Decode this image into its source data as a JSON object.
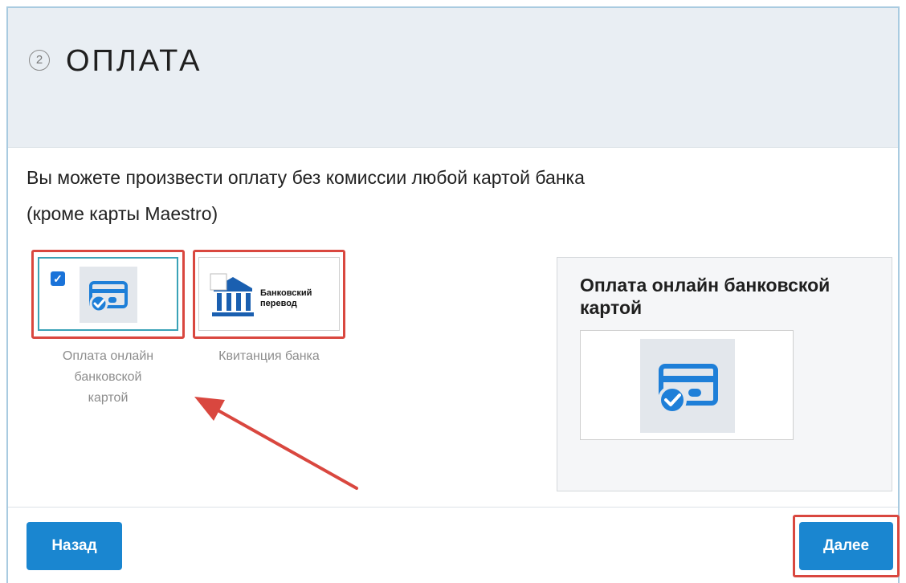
{
  "header": {
    "step_number": "2",
    "title": "ОПЛАТА"
  },
  "description": {
    "line1": "Вы можете произвести оплату без комиссии любой картой банка",
    "line2": "(кроме карты Maestro)"
  },
  "payment_options": [
    {
      "label_lines": [
        "Оплата онлайн",
        "банковской",
        "картой"
      ],
      "selected": true,
      "icon": "credit-card-icon"
    },
    {
      "label_lines": [
        "Квитанция банка"
      ],
      "selected": false,
      "icon": "bank-building-icon",
      "logo_text": [
        "Банковский",
        "перевод"
      ]
    }
  ],
  "summary": {
    "title": "Оплата онлайн банковской картой",
    "icon": "credit-card-icon"
  },
  "buttons": {
    "back": "Назад",
    "next": "Далее"
  },
  "colors": {
    "accent": "#1a86d0",
    "highlight": "#d9473f",
    "selected_border": "#3aa2b7",
    "card_icon": "#1e7fd8"
  }
}
